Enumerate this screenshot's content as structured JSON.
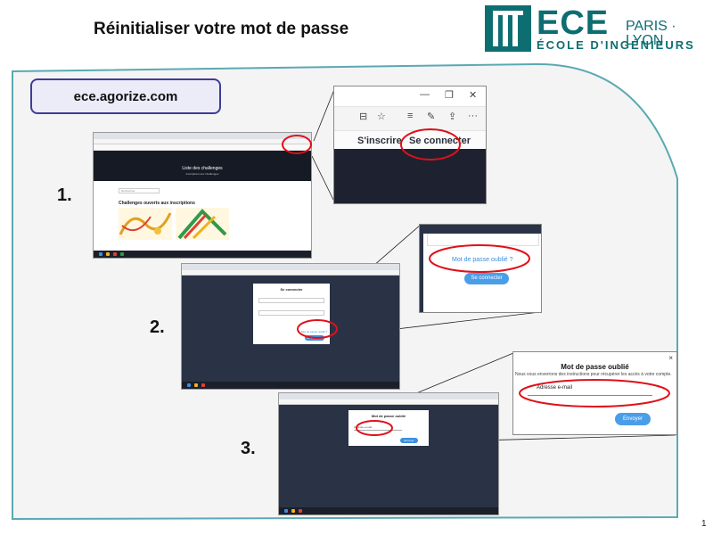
{
  "title": "Réinitialiser votre mot de passe",
  "logo": {
    "name": "ECE",
    "city": "PARIS · LYON",
    "subtitle": "ÉCOLE D'INGÉNIEURS"
  },
  "url_label": "ece.agorize.com",
  "steps": [
    "1.",
    "2.",
    "3."
  ],
  "shot1": {
    "hero_title": "Liste des challenges",
    "hero_sub": "Inscriptions aux Challenges",
    "search_placeholder": "Rechercher",
    "section_title": "Challenges ouverts aux inscriptions"
  },
  "zoom1": {
    "inscrire": "S'inscrire",
    "connecter": "Se connecter",
    "window_controls": [
      "—",
      "❐",
      "✕"
    ],
    "toolbar_icons": [
      "⊟",
      "☆",
      "≡",
      "✎",
      "⇪",
      "···"
    ]
  },
  "shot2": {
    "modal_title": "Se connecter",
    "link": "Mot de passe oublié ?",
    "button": "Se connecter"
  },
  "zoom2": {
    "link": "Mot de passe oublié ?",
    "button": "Se connecter"
  },
  "shot3": {
    "modal_title": "Mot de passe oublié",
    "field": "Adresse e-mail",
    "button": "Envoyer"
  },
  "zoom3": {
    "title": "Mot de passe oublié",
    "description": "Nous vous enverrons des instructions pour récupérer les accès à votre compte.",
    "field_label": "Adresse e-mail",
    "button": "Envoyer",
    "close": "×"
  },
  "page_number": "1",
  "colors": {
    "brand": "#0d6e72",
    "frame": "#5aa9b3",
    "highlight": "#e0101a",
    "button_blue": "#4a9ee8",
    "url_border": "#3e3d97"
  }
}
